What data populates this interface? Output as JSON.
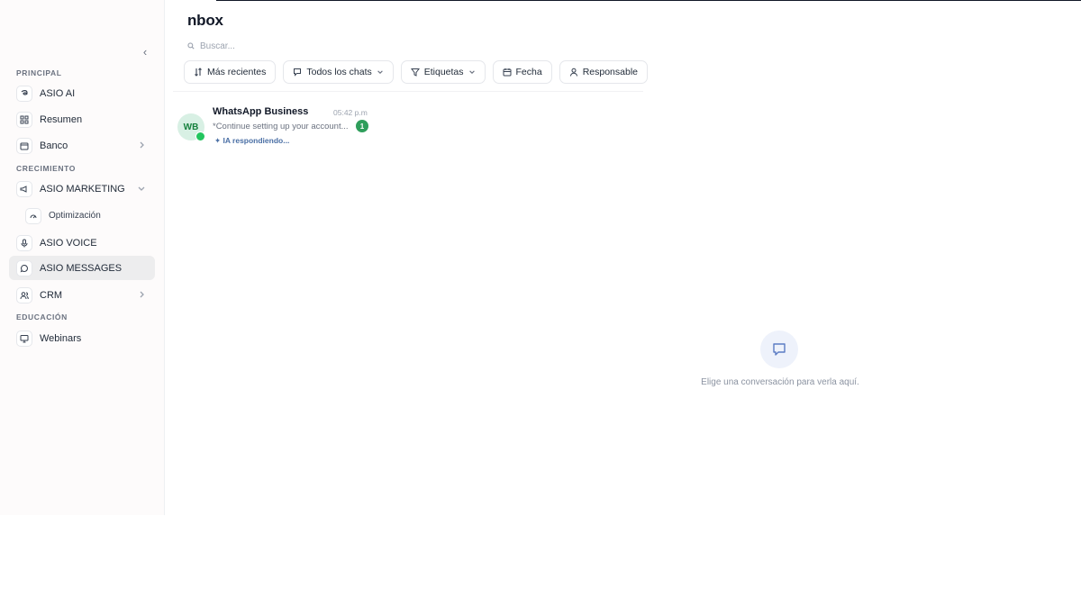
{
  "header": {
    "title": "nbox",
    "search_placeholder": "Buscar..."
  },
  "filters": [
    {
      "label": "Más recientes",
      "icon": "sort-icon"
    },
    {
      "label": "Todos los chats",
      "icon": "chat-icon"
    },
    {
      "label": "Etiquetas",
      "icon": "filter-icon"
    },
    {
      "label": "Fecha",
      "icon": "calendar-icon"
    },
    {
      "label": "Responsable",
      "icon": "user-icon"
    }
  ],
  "sidebar": {
    "sections": {
      "principal": "PRINCIPAL",
      "crecimiento": "CRECIMIENTO",
      "educacion": "EDUCACIÓN"
    },
    "items": [
      {
        "label": "ASIO AI",
        "icon": "ai-icon"
      },
      {
        "label": "Resumen",
        "icon": "grid-icon"
      },
      {
        "label": "Banco",
        "icon": "wallet-icon"
      },
      {
        "label": "ASIO MARKETING",
        "icon": "megaphone-icon"
      },
      {
        "label": "Optimización",
        "icon": "gauge-icon"
      },
      {
        "label": "ASIO VOICE",
        "icon": "mic-icon"
      },
      {
        "label": "ASIO MESSAGES",
        "icon": "message-icon"
      },
      {
        "label": "CRM",
        "icon": "users-icon"
      },
      {
        "label": "Webinars",
        "icon": "monitor-icon"
      }
    ]
  },
  "conversations": [
    {
      "initials": "WB",
      "name": "WhatsApp Business",
      "time": "05:42 p.m",
      "preview": "*Continue setting up your account...",
      "unread": "1",
      "status": "IA respondiendo..."
    }
  ],
  "empty_state": {
    "text": "Elige una conversación para verla aquí."
  },
  "colors": {
    "active_bg": "#ededee",
    "unread_badge": "#2f9e5b",
    "status_text": "#4a6fa5",
    "empty_icon_bg": "#eef2fb"
  }
}
